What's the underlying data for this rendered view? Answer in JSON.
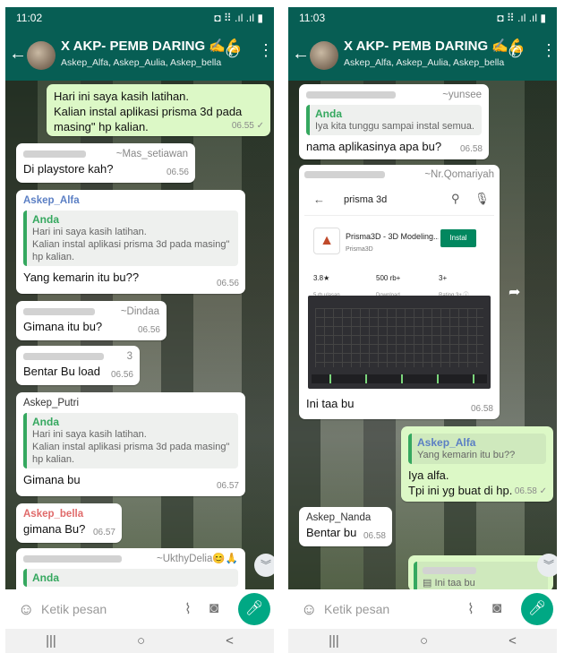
{
  "ui": {
    "colors": {
      "header": "#075e54",
      "outgoing": "#dcf8c6",
      "mic": "#00a884",
      "quote_bar": "#35a85f",
      "alfa": "#5b7fc4",
      "bella": "#e06a6a"
    },
    "icons": [
      "back-arrow-icon",
      "add-call-icon",
      "menu-dots-icon",
      "emoji-icon",
      "attach-icon",
      "camera-icon",
      "mic-icon",
      "scroll-down-icon",
      "share-icon",
      "search-icon"
    ]
  },
  "phone1": {
    "status": {
      "time": "11:02",
      "icons": "◘ ⠿ .ıl .ıl ▮"
    },
    "header": {
      "title": "X AKP- PEMB DARING ✍💪",
      "subtitle": "Askep_Alfa, Askep_Aulia, Askep_bella, As..."
    },
    "messages": [
      {
        "text1": "Hari ini saya kasih latihan.",
        "text2": "Kalian instal aplikasi prisma 3d pada masing\" hp kalian.",
        "time": "06.55 ✓"
      },
      {
        "sender": "~Mas_setiawan",
        "text": "Di playstore kah?",
        "time": "06.56"
      },
      {
        "sender": "Askep_Alfa",
        "quote_author": "Anda",
        "quote1": "Hari ini saya kasih latihan.",
        "quote2": "Kalian instal aplikasi prisma 3d pada masing\" hp kalian.",
        "text": "Yang kemarin itu bu??",
        "time": "06.56"
      },
      {
        "sender": "~Dindaa",
        "text": "Gimana itu bu?",
        "time": "06.56"
      },
      {
        "sender": "3",
        "text": "Bentar Bu load",
        "time": "06.56"
      },
      {
        "sender": "Askep_Putri",
        "quote_author": "Anda",
        "quote1": "Hari ini saya kasih latihan.",
        "quote2": "Kalian instal aplikasi prisma 3d pada masing\" hp kalian.",
        "text": "Gimana bu",
        "time": "06.57"
      },
      {
        "sender": "Askep_bella",
        "text": "gimana Bu?",
        "time": "06.57"
      },
      {
        "sender": "~UkthyDelia😊🙏",
        "quote_author": "Anda"
      }
    ],
    "input": {
      "placeholder": "Ketik pesan"
    }
  },
  "phone2": {
    "status": {
      "time": "11:03",
      "icons": "◘ ⠿ .ıl .ıl ▮"
    },
    "header": {
      "title": "X AKP- PEMB DARING ✍💪",
      "subtitle": "Askep_Alfa, Askep_Aulia, Askep_bella, As..."
    },
    "messages": [
      {
        "sender": "~yunsee",
        "quote_author": "Anda",
        "quote1": "Iya kita tunggu sampai instal semua.",
        "text": "nama aplikasinya apa bu?",
        "time": "06.58"
      },
      {
        "sender": "~Nr.Qomariyah",
        "text": "Ini taa bu",
        "time": "06.58",
        "playstore": {
          "search": "prisma 3d",
          "app_name": "Prisma3D - 3D Modeling...",
          "developer": "Prisma3D",
          "install": "Instal",
          "rating": "3.8★",
          "rating_label": "5 rb ulasan",
          "downloads": "500 rb+",
          "downloads_label": "Download",
          "age": "3+",
          "age_label": "Rating 3+ ⓘ"
        }
      },
      {
        "quote_author": "Askep_Alfa",
        "quote1": "Yang kemarin itu bu??",
        "text1": "Iya alfa.",
        "text2": "Tpi ini yg buat di hp.",
        "time": "06.58 ✓"
      },
      {
        "sender": "Askep_Nanda",
        "text": "Bentar bu",
        "time": "06.58"
      },
      {
        "quote1": "▤ Ini taa bu"
      }
    ],
    "input": {
      "placeholder": "Ketik pesan"
    }
  },
  "navbar": {
    "recent": "|||",
    "home": "○",
    "back": "<"
  }
}
